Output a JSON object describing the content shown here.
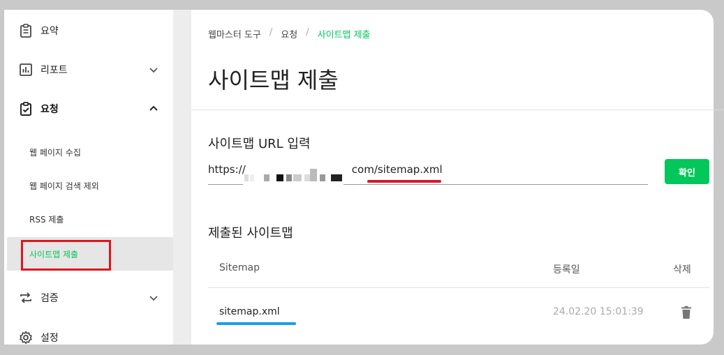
{
  "sidebar": {
    "items": [
      {
        "label": "요약",
        "icon": "clipboard-icon"
      },
      {
        "label": "리포트",
        "icon": "bar-chart-icon"
      },
      {
        "label": "요청",
        "icon": "clipboard-check-icon"
      },
      {
        "label": "검증",
        "icon": "repeat-icon"
      },
      {
        "label": "설정",
        "icon": "gear-icon"
      }
    ],
    "sub_items": [
      {
        "label": "웹 페이지 수집"
      },
      {
        "label": "웹 페이지 검색 제외"
      },
      {
        "label": "RSS 제출"
      },
      {
        "label": "사이트맵 제출"
      }
    ]
  },
  "breadcrumb": [
    "웹마스터 도구",
    "요청",
    "사이트맵 제출"
  ],
  "page_title": "사이트맵 제출",
  "url_section": {
    "label": "사이트맵 URL 입력",
    "value_prefix": "https://",
    "value_suffix": "com/sitemap.xml",
    "button_label": "확인"
  },
  "submitted": {
    "label": "제출된 사이트맵",
    "columns": [
      "Sitemap",
      "등록일",
      "삭제"
    ],
    "rows": [
      {
        "file": "sitemap.xml",
        "date": "24.02.20 15:01:39"
      }
    ]
  },
  "colors": {
    "accent": "#03c75a",
    "highlight_red": "#e0151e",
    "highlight_blue": "#1aa0e4"
  }
}
